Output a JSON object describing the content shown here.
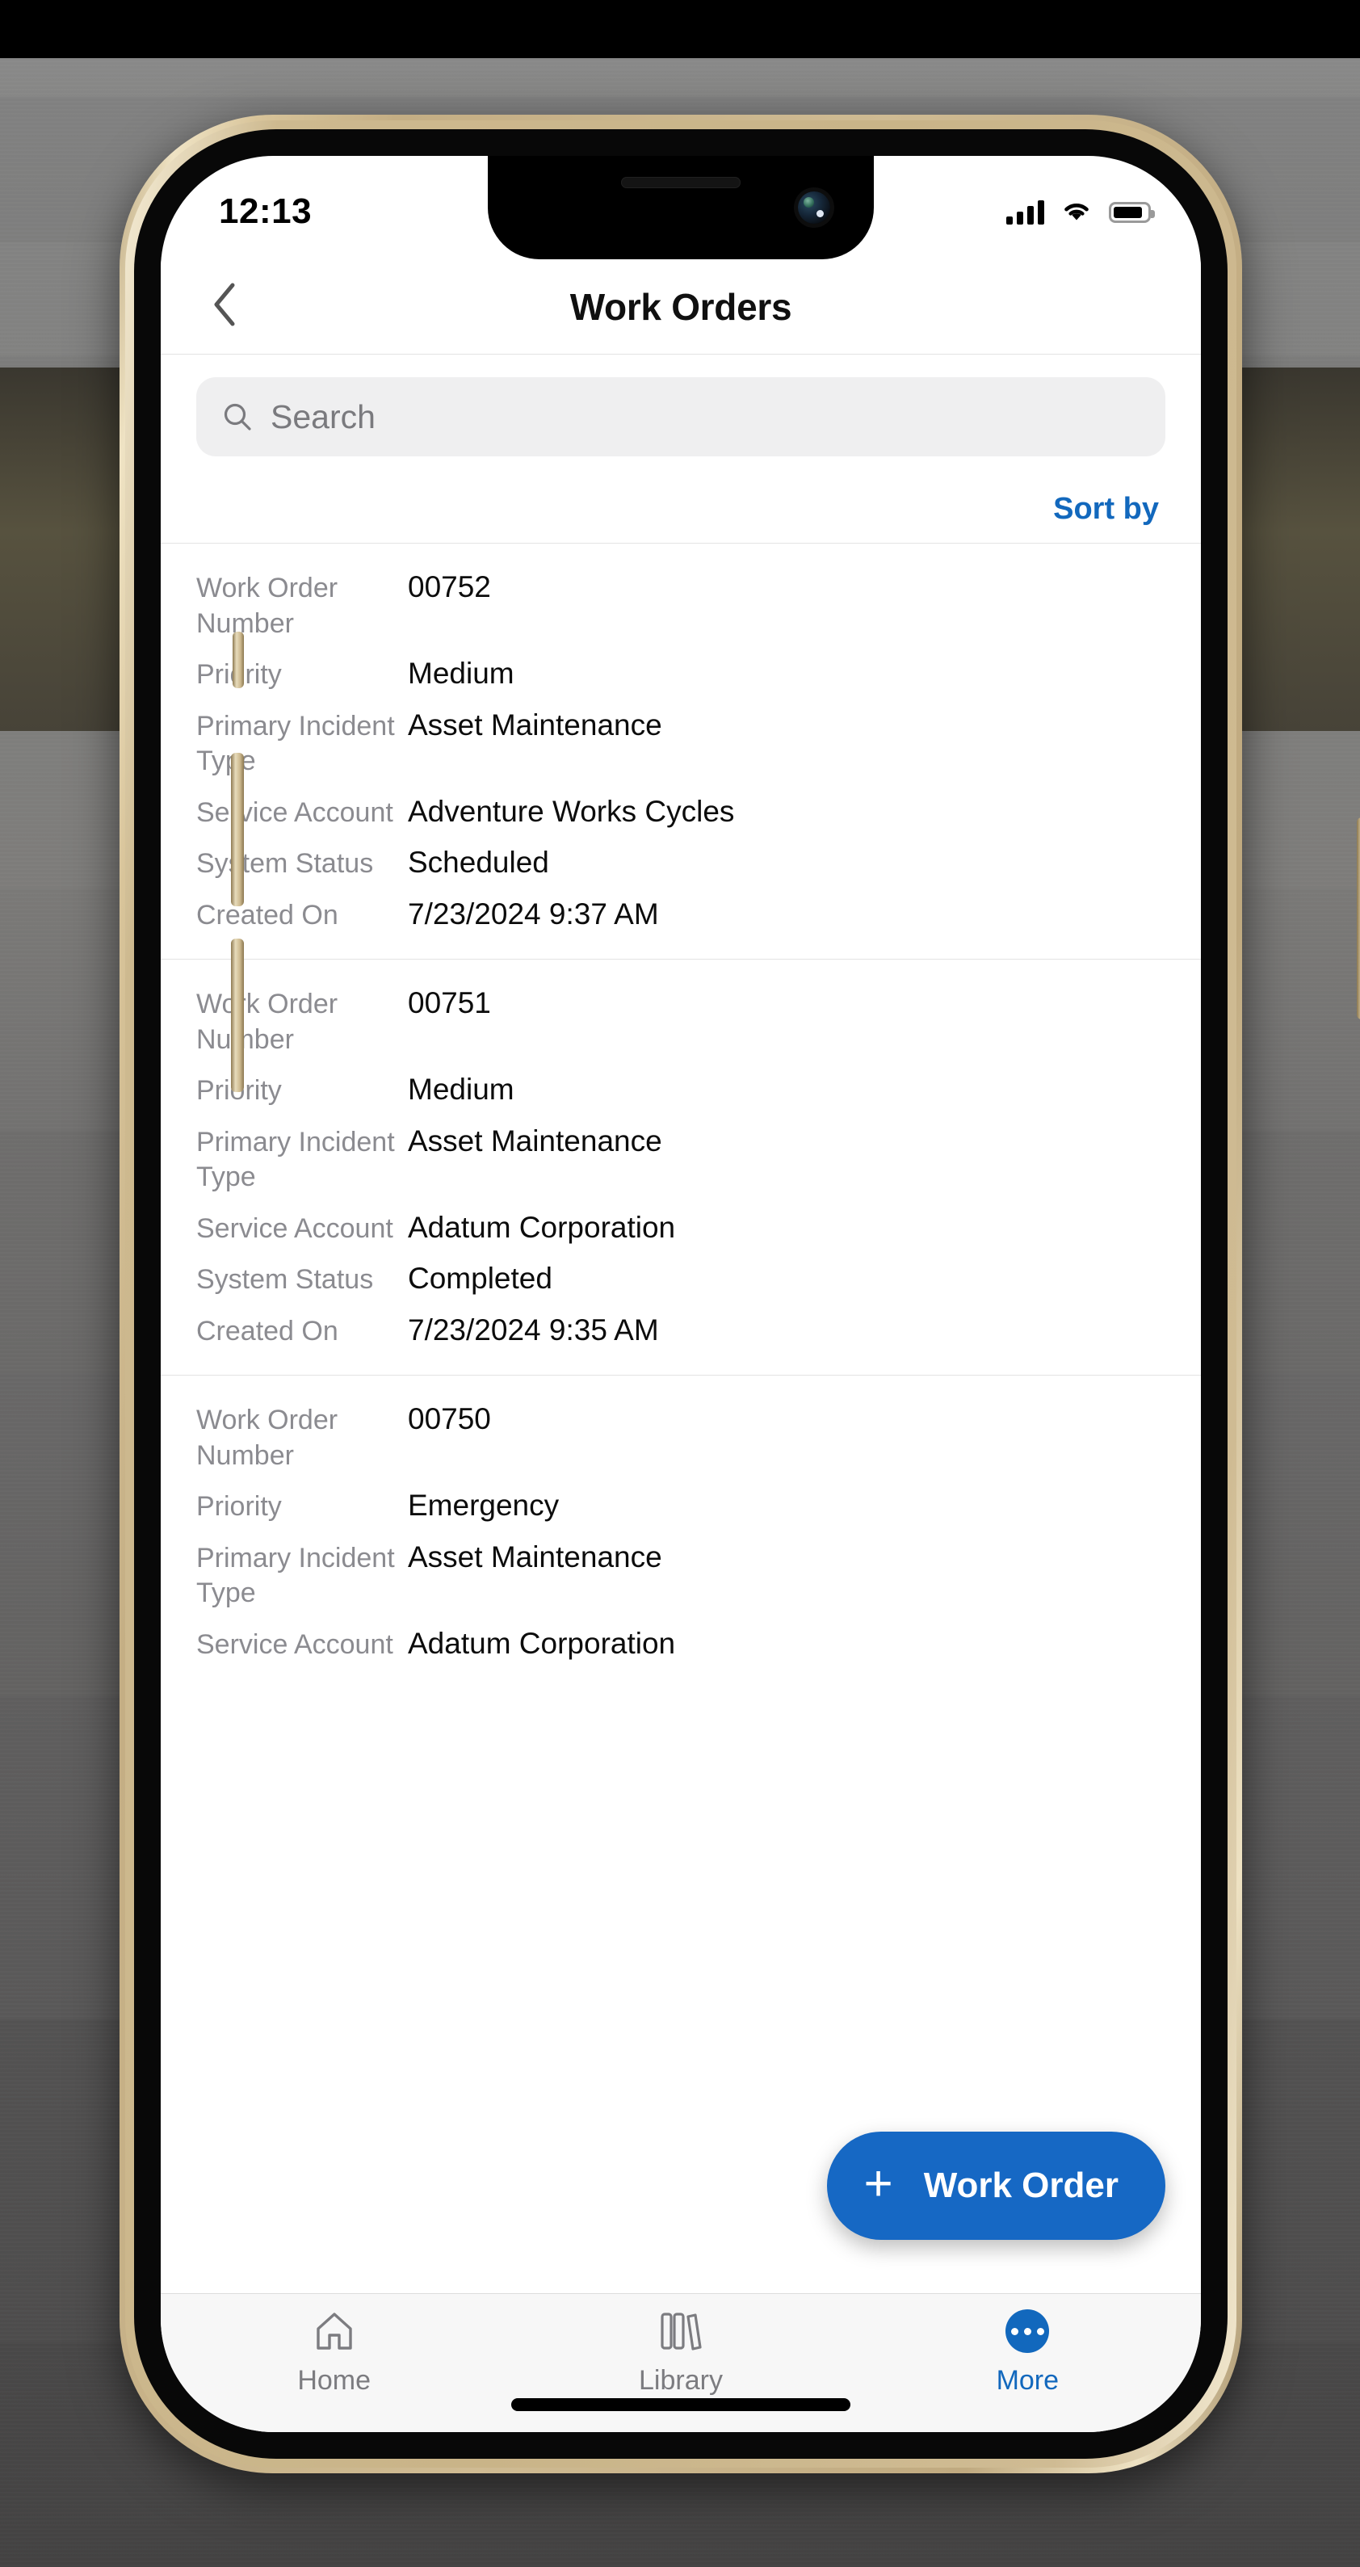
{
  "status_bar": {
    "time": "12:13",
    "signal_icon": "cellular-signal-icon",
    "wifi_icon": "wifi-icon",
    "battery_icon": "battery-icon"
  },
  "nav": {
    "title": "Work Orders",
    "back_icon": "chevron-left-icon"
  },
  "search": {
    "placeholder": "Search",
    "icon": "search-icon",
    "value": ""
  },
  "toolbar": {
    "sort_by_label": "Sort by"
  },
  "field_labels": {
    "work_order_number": "Work Order Number",
    "priority": "Priority",
    "primary_incident_type": "Primary Incident Type",
    "service_account": "Service Account",
    "system_status": "System Status",
    "created_on": "Created On"
  },
  "work_orders": [
    {
      "work_order_number": "00752",
      "priority": "Medium",
      "primary_incident_type": "Asset Maintenance",
      "service_account": "Adventure Works Cycles",
      "system_status": "Scheduled",
      "created_on": "7/23/2024 9:37 AM"
    },
    {
      "work_order_number": "00751",
      "priority": "Medium",
      "primary_incident_type": "Asset Maintenance",
      "service_account": "Adatum Corporation",
      "system_status": "Completed",
      "created_on": "7/23/2024 9:35 AM"
    },
    {
      "work_order_number": "00750",
      "priority": "Emergency",
      "primary_incident_type": "Asset Maintenance",
      "service_account": "Adatum Corporation"
    }
  ],
  "fab": {
    "plus": "+",
    "label": "Work Order",
    "icon": "plus-icon",
    "color": "#1668c4"
  },
  "tab_bar": {
    "items": [
      {
        "label": "Home",
        "icon": "home-icon",
        "active": false
      },
      {
        "label": "Library",
        "icon": "library-books-icon",
        "active": false
      },
      {
        "label": "More",
        "icon": "ellipsis-circle-icon",
        "active": true
      }
    ]
  },
  "colors": {
    "accent": "#1268bd",
    "fab": "#1668c4",
    "label_gray": "#8b8b90",
    "value_black": "#0c0c0c"
  }
}
